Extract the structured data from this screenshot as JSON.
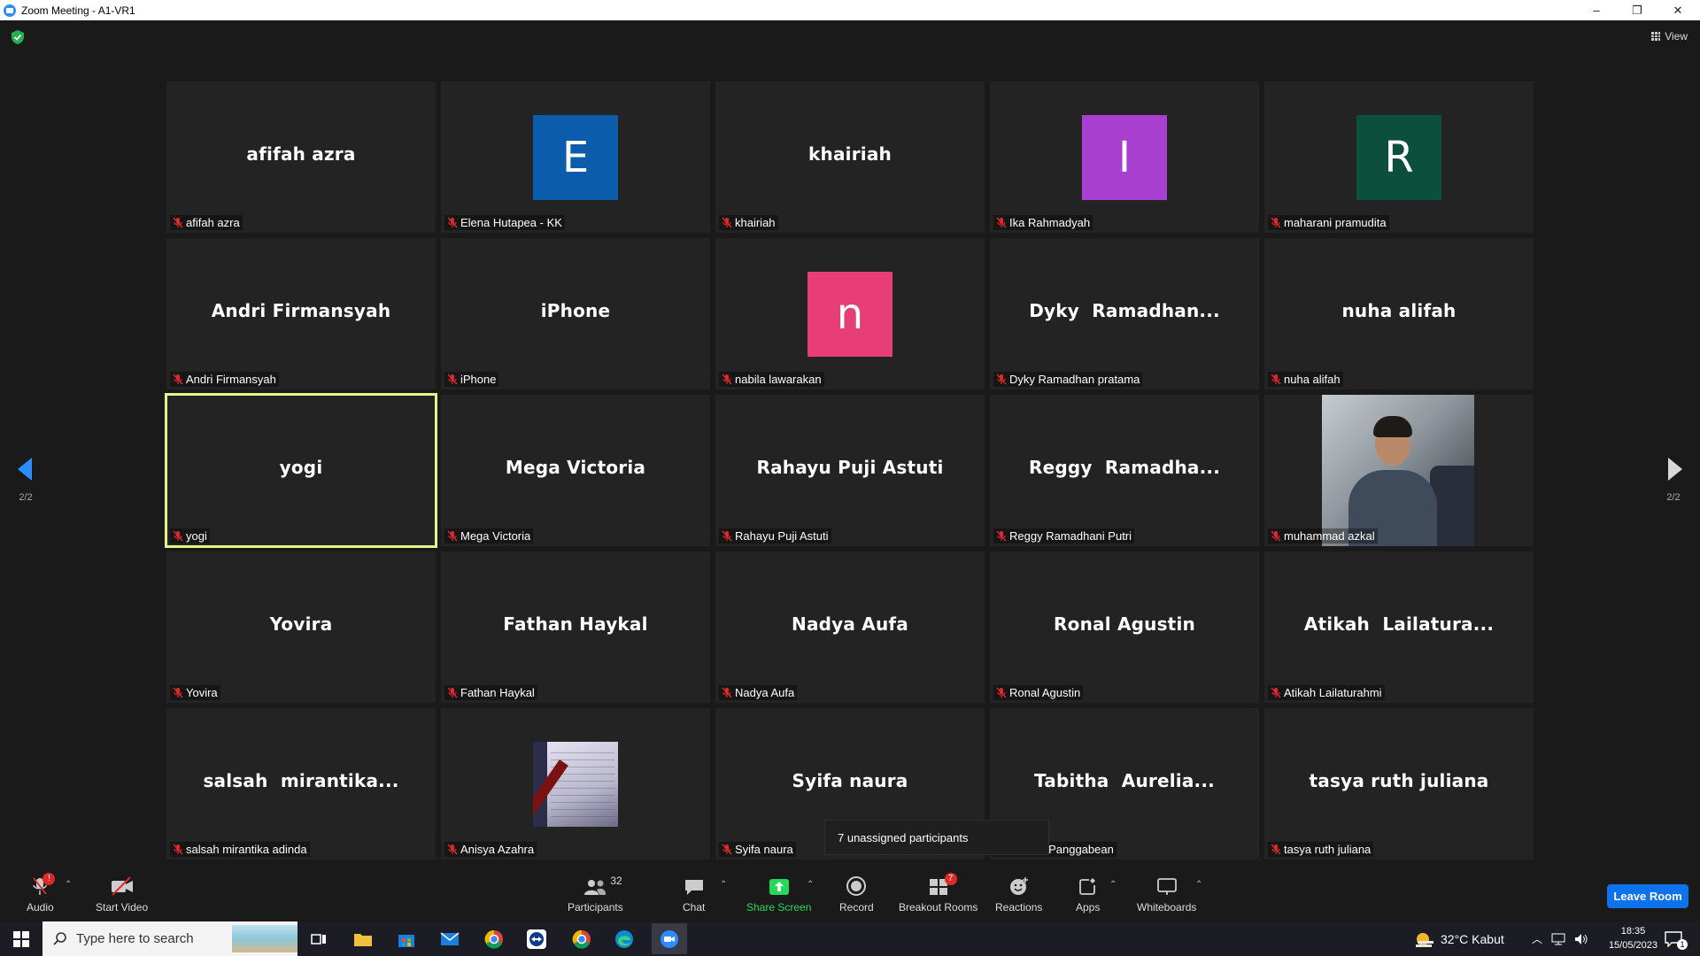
{
  "window": {
    "title": "Zoom Meeting - A1-VR1",
    "minimize": "–",
    "restore": "❐",
    "close": "✕"
  },
  "top": {
    "view_label": "View"
  },
  "pager": {
    "left_page": "2/2",
    "right_page": "2/2"
  },
  "tiles": [
    {
      "big": "afifah azra",
      "label": "afifah azra"
    },
    {
      "big": "",
      "avatar": "E",
      "avatar_color": "#0b5cab",
      "label": "Elena Hutapea - KK"
    },
    {
      "big": "khairiah",
      "label": "khairiah"
    },
    {
      "big": "",
      "avatar": "I",
      "avatar_color": "#a93fd1",
      "label": "Ika Rahmadyah"
    },
    {
      "big": "",
      "avatar": "R",
      "avatar_color": "#0c4f3c",
      "label": "maharani pramudita"
    },
    {
      "big": "Andri Firmansyah",
      "label": "Andri Firmansyah"
    },
    {
      "big": "iPhone",
      "label": "iPhone"
    },
    {
      "big": "",
      "avatar": "n",
      "avatar_color": "#e83e78",
      "label": "nabila lawarakan"
    },
    {
      "big": "Dyky  Ramadhan...",
      "label": "Dyky Ramadhan pratama"
    },
    {
      "big": "nuha alifah",
      "label": "nuha alifah"
    },
    {
      "big": "yogi",
      "label": "yogi",
      "active": true
    },
    {
      "big": "Mega Victoria",
      "label": "Mega Victoria"
    },
    {
      "big": "Rahayu Puji Astuti",
      "label": "Rahayu Puji Astuti"
    },
    {
      "big": "Reggy  Ramadha...",
      "label": "Reggy Ramadhani Putri"
    },
    {
      "big": "",
      "video": "photo",
      "label": "muhammad azkal"
    },
    {
      "big": "Yovira",
      "label": "Yovira"
    },
    {
      "big": "Fathan Haykal",
      "label": "Fathan Haykal"
    },
    {
      "big": "Nadya Aufa",
      "label": "Nadya Aufa"
    },
    {
      "big": "Ronal Agustin",
      "label": "Ronal Agustin"
    },
    {
      "big": "Atikah  Lailatura...",
      "label": "Atikah Lailaturahmi"
    },
    {
      "big": "salsah  mirantika...",
      "label": "salsah mirantika adinda"
    },
    {
      "big": "",
      "video": "paper",
      "label": "Anisya Azahra"
    },
    {
      "big": "Syifa naura",
      "label": "Syifa naura"
    },
    {
      "big": "Tabitha  Aurelia...",
      "label": "Aurelia Panggabean"
    },
    {
      "big": "tasya ruth juliana",
      "label": "tasya ruth juliana"
    }
  ],
  "tooltip": "7 unassigned participants",
  "toolbar": {
    "audio": "Audio",
    "audio_badge": "!",
    "start_video": "Start Video",
    "participants": "Participants",
    "participants_count": "32",
    "chat": "Chat",
    "share_screen": "Share Screen",
    "record": "Record",
    "breakout_rooms": "Breakout Rooms",
    "breakout_badge": "7",
    "reactions": "Reactions",
    "apps": "Apps",
    "whiteboards": "Whiteboards",
    "leave": "Leave Room"
  },
  "taskbar": {
    "search_placeholder": "Type here to search",
    "weather": "32°C  Kabut",
    "time": "18:35",
    "date": "15/05/2023",
    "notif_count": "1"
  },
  "colors": {
    "accent": "#0e72ed",
    "share_green": "#23d959",
    "active_border": "#e9f28a",
    "mute_red": "#e02828"
  }
}
